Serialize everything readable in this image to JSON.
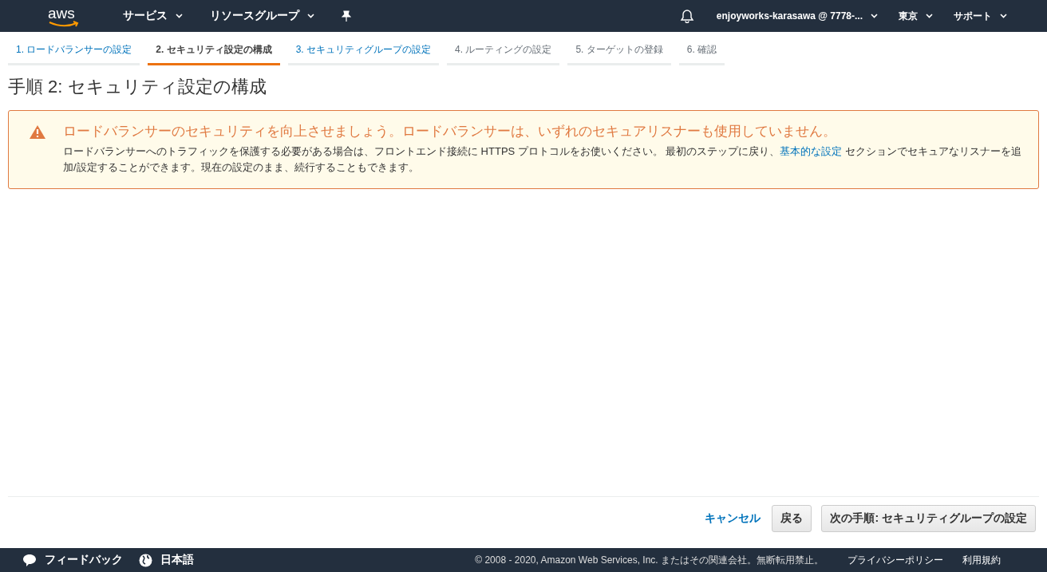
{
  "header": {
    "logo": "aws",
    "menus": [
      {
        "label": "サービス"
      },
      {
        "label": "リソースグループ"
      }
    ],
    "account": "enjoyworks-karasawa @ 7778-...",
    "region": "東京",
    "support": "サポート"
  },
  "steps": [
    {
      "label": "1. ロードバランサーの設定",
      "selected": false,
      "disabled": false
    },
    {
      "label": "2. セキュリティ設定の構成",
      "selected": true,
      "disabled": false
    },
    {
      "label": "3. セキュリティグループの設定",
      "selected": false,
      "disabled": false
    },
    {
      "label": "4. ルーティングの設定",
      "selected": false,
      "disabled": true
    },
    {
      "label": "5. ターゲットの登録",
      "selected": false,
      "disabled": true
    },
    {
      "label": "6. 確認",
      "selected": false,
      "disabled": true
    }
  ],
  "title": "手順 2: セキュリティ設定の構成",
  "alert": {
    "heading": "ロードバランサーのセキュリティを向上させましょう。ロードバランサーは、いずれのセキュアリスナーも使用していません。",
    "body_before": "ロードバランサーへのトラフィックを保護する必要がある場合は、フロントエンド接続に HTTPS プロトコルをお使いください。 最初のステップに戻り、",
    "link": "基本的な設定",
    "body_after": " セクションでセキュアなリスナーを追加/設定することができます。現在の設定のまま、続行することもできます。"
  },
  "actions": {
    "cancel": "キャンセル",
    "back": "戻る",
    "next": "次の手順: セキュリティグループの設定"
  },
  "footer": {
    "feedback": "フィードバック",
    "language": "日本語",
    "copyright": "© 2008 - 2020, Amazon Web Services, Inc. またはその関連会社。無断転用禁止。",
    "privacy": "プライバシーポリシー",
    "terms": "利用規約"
  }
}
